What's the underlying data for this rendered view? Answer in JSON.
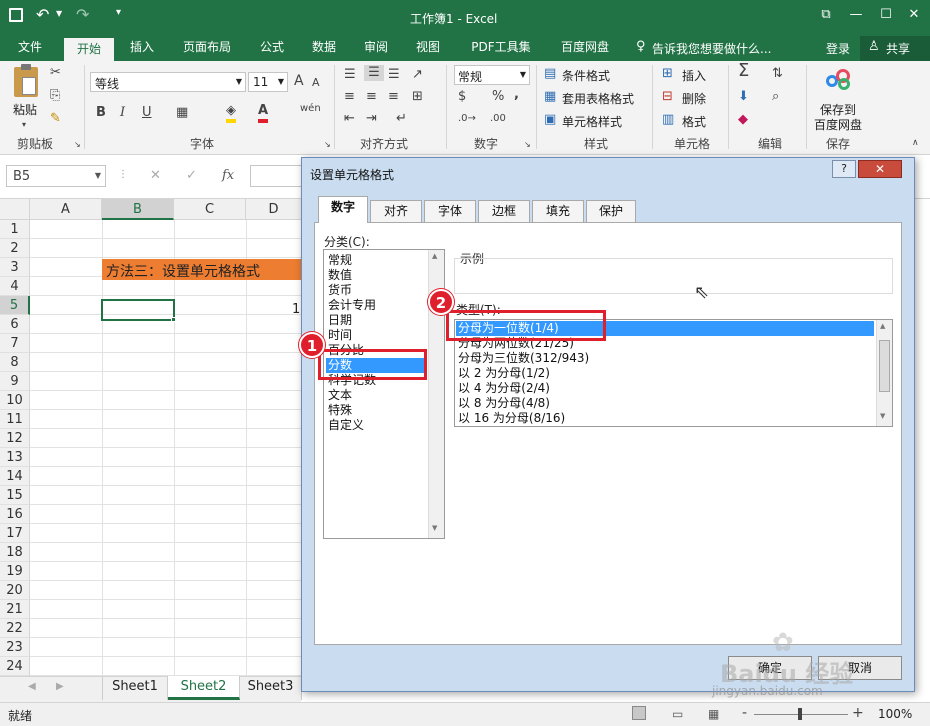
{
  "window": {
    "title": "工作簿1 - Excel",
    "restore_glyph": "⧉",
    "min_glyph": "—",
    "max_glyph": "☐",
    "close_glyph": "✕"
  },
  "qat": {
    "save_icon": "save-icon",
    "undo_icon": "undo-icon",
    "redo_icon": "redo-icon"
  },
  "tabs": [
    "文件",
    "开始",
    "插入",
    "页面布局",
    "公式",
    "数据",
    "审阅",
    "视图",
    "PDF工具集",
    "百度网盘"
  ],
  "tell_me": "告诉我您想要做什么...",
  "login": "登录",
  "share": "共享",
  "ribbon": {
    "clipboard": {
      "paste": "粘贴",
      "label": "剪贴板"
    },
    "font": {
      "name": "等线",
      "size": "11",
      "label": "字体",
      "bold": "B",
      "italic": "I",
      "underline": "U",
      "grow": "A",
      "shrink": "A",
      "wen": "wén"
    },
    "align": {
      "label": "对齐方式"
    },
    "number": {
      "format": "常规",
      "label": "数字",
      "percent": "%",
      "comma": ","
    },
    "styles": {
      "cond": "条件格式",
      "table": "套用表格格式",
      "cell": "单元格样式",
      "label": "样式"
    },
    "cells": {
      "insert": "插入",
      "delete": "删除",
      "format": "格式",
      "label": "单元格"
    },
    "edit": {
      "label": "编辑",
      "sigma": "Σ"
    },
    "save": {
      "line1": "保存到",
      "line2": "百度网盘",
      "label": "保存"
    }
  },
  "formula_bar": {
    "name_box": "B5",
    "fx": "fx",
    "cancel": "✕",
    "enter": "✓"
  },
  "columns": [
    "A",
    "B",
    "C",
    "D"
  ],
  "rows": [
    "1",
    "2",
    "3",
    "4",
    "5",
    "6",
    "7",
    "8",
    "9",
    "10",
    "11",
    "12",
    "13",
    "14",
    "15",
    "16",
    "17",
    "18",
    "19",
    "20",
    "21",
    "22",
    "23",
    "24"
  ],
  "cells": {
    "b3": "方法三：设置单元格格式",
    "d5": "1"
  },
  "sheets": [
    "Sheet1",
    "Sheet2",
    "Sheet3"
  ],
  "status": {
    "ready": "就绪",
    "zoom": "100%",
    "minus": "-",
    "plus": "+"
  },
  "dialog": {
    "title": "设置单元格格式",
    "help": "?",
    "tabs": [
      "数字",
      "对齐",
      "字体",
      "边框",
      "填充",
      "保护"
    ],
    "category_label": "分类(C):",
    "categories": [
      "常规",
      "数值",
      "货币",
      "会计专用",
      "日期",
      "时间",
      "百分比",
      "分数",
      "科学记数",
      "文本",
      "特殊",
      "自定义"
    ],
    "selected_category": "分数",
    "sample_label": "示例",
    "type_label": "类型(T):",
    "types": [
      "分母为一位数(1/4)",
      "分母为两位数(21/25)",
      "分母为三位数(312/943)",
      "以 2 为分母(1/2)",
      "以 4 为分母(2/4)",
      "以 8 为分母(4/8)",
      "以 16 为分母(8/16)"
    ],
    "selected_type": "分母为一位数(1/4)",
    "ok": "确定",
    "cancel": "取消"
  },
  "badges": [
    "1",
    "2"
  ],
  "watermark": {
    "brand": "Baidu 经验",
    "url": "jingyan.baidu.com"
  },
  "colors": {
    "excel_green": "#217346",
    "highlight_orange": "#ed7d31",
    "selection_blue": "#3399ff",
    "annotation_red": "#e01f2c"
  }
}
